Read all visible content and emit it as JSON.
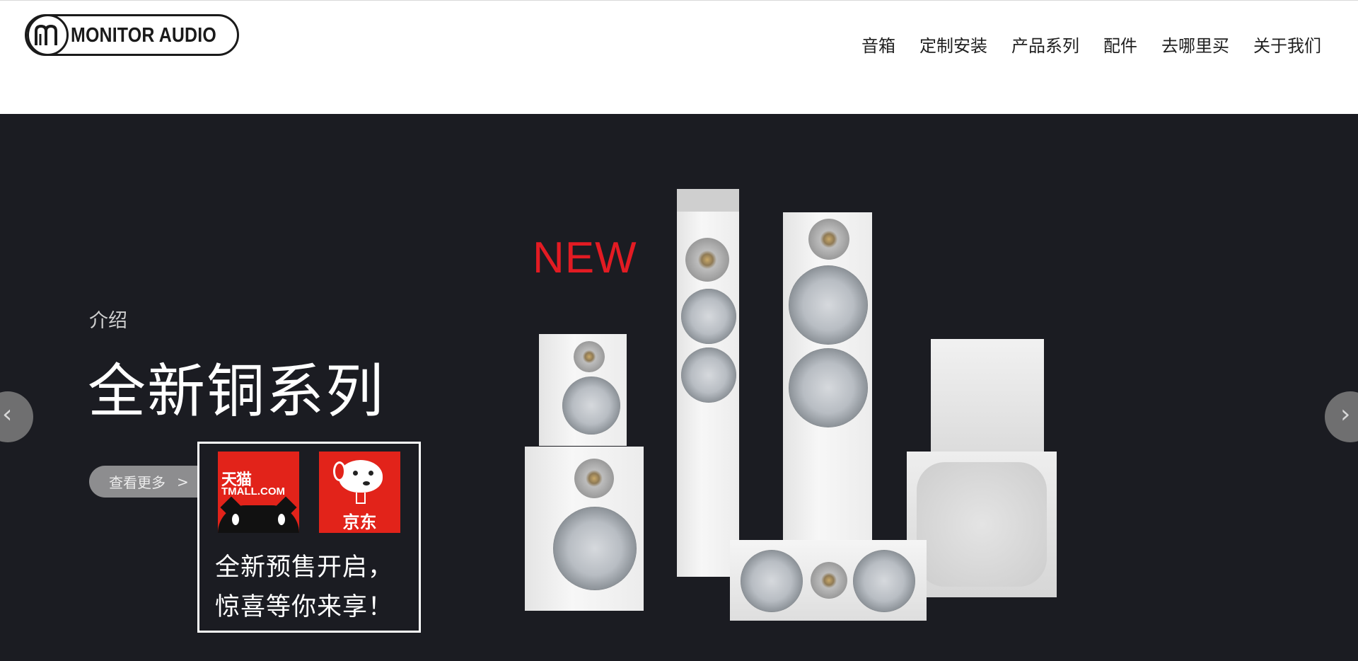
{
  "header": {
    "logo_text": "MONITOR AUDIO",
    "nav": [
      "音箱",
      "定制安装",
      "产品系列",
      "配件",
      "去哪里买",
      "关于我们"
    ]
  },
  "hero": {
    "kicker": "介绍",
    "title": "全新铜系列",
    "more_button": "查看更多",
    "more_chevron": ">",
    "new_badge": "NEW",
    "promo": {
      "tmall_cn": "天猫",
      "tmall_en": "TMALL.COM",
      "jd": "京东",
      "line1": "全新预售开启，",
      "line2": "惊喜等你来享！"
    },
    "prev_arrow": "‹",
    "next_arrow": "›"
  },
  "colors": {
    "hero_bg": "#1b1c22",
    "new_red": "#e31b23",
    "brand_red": "#e2231a"
  }
}
